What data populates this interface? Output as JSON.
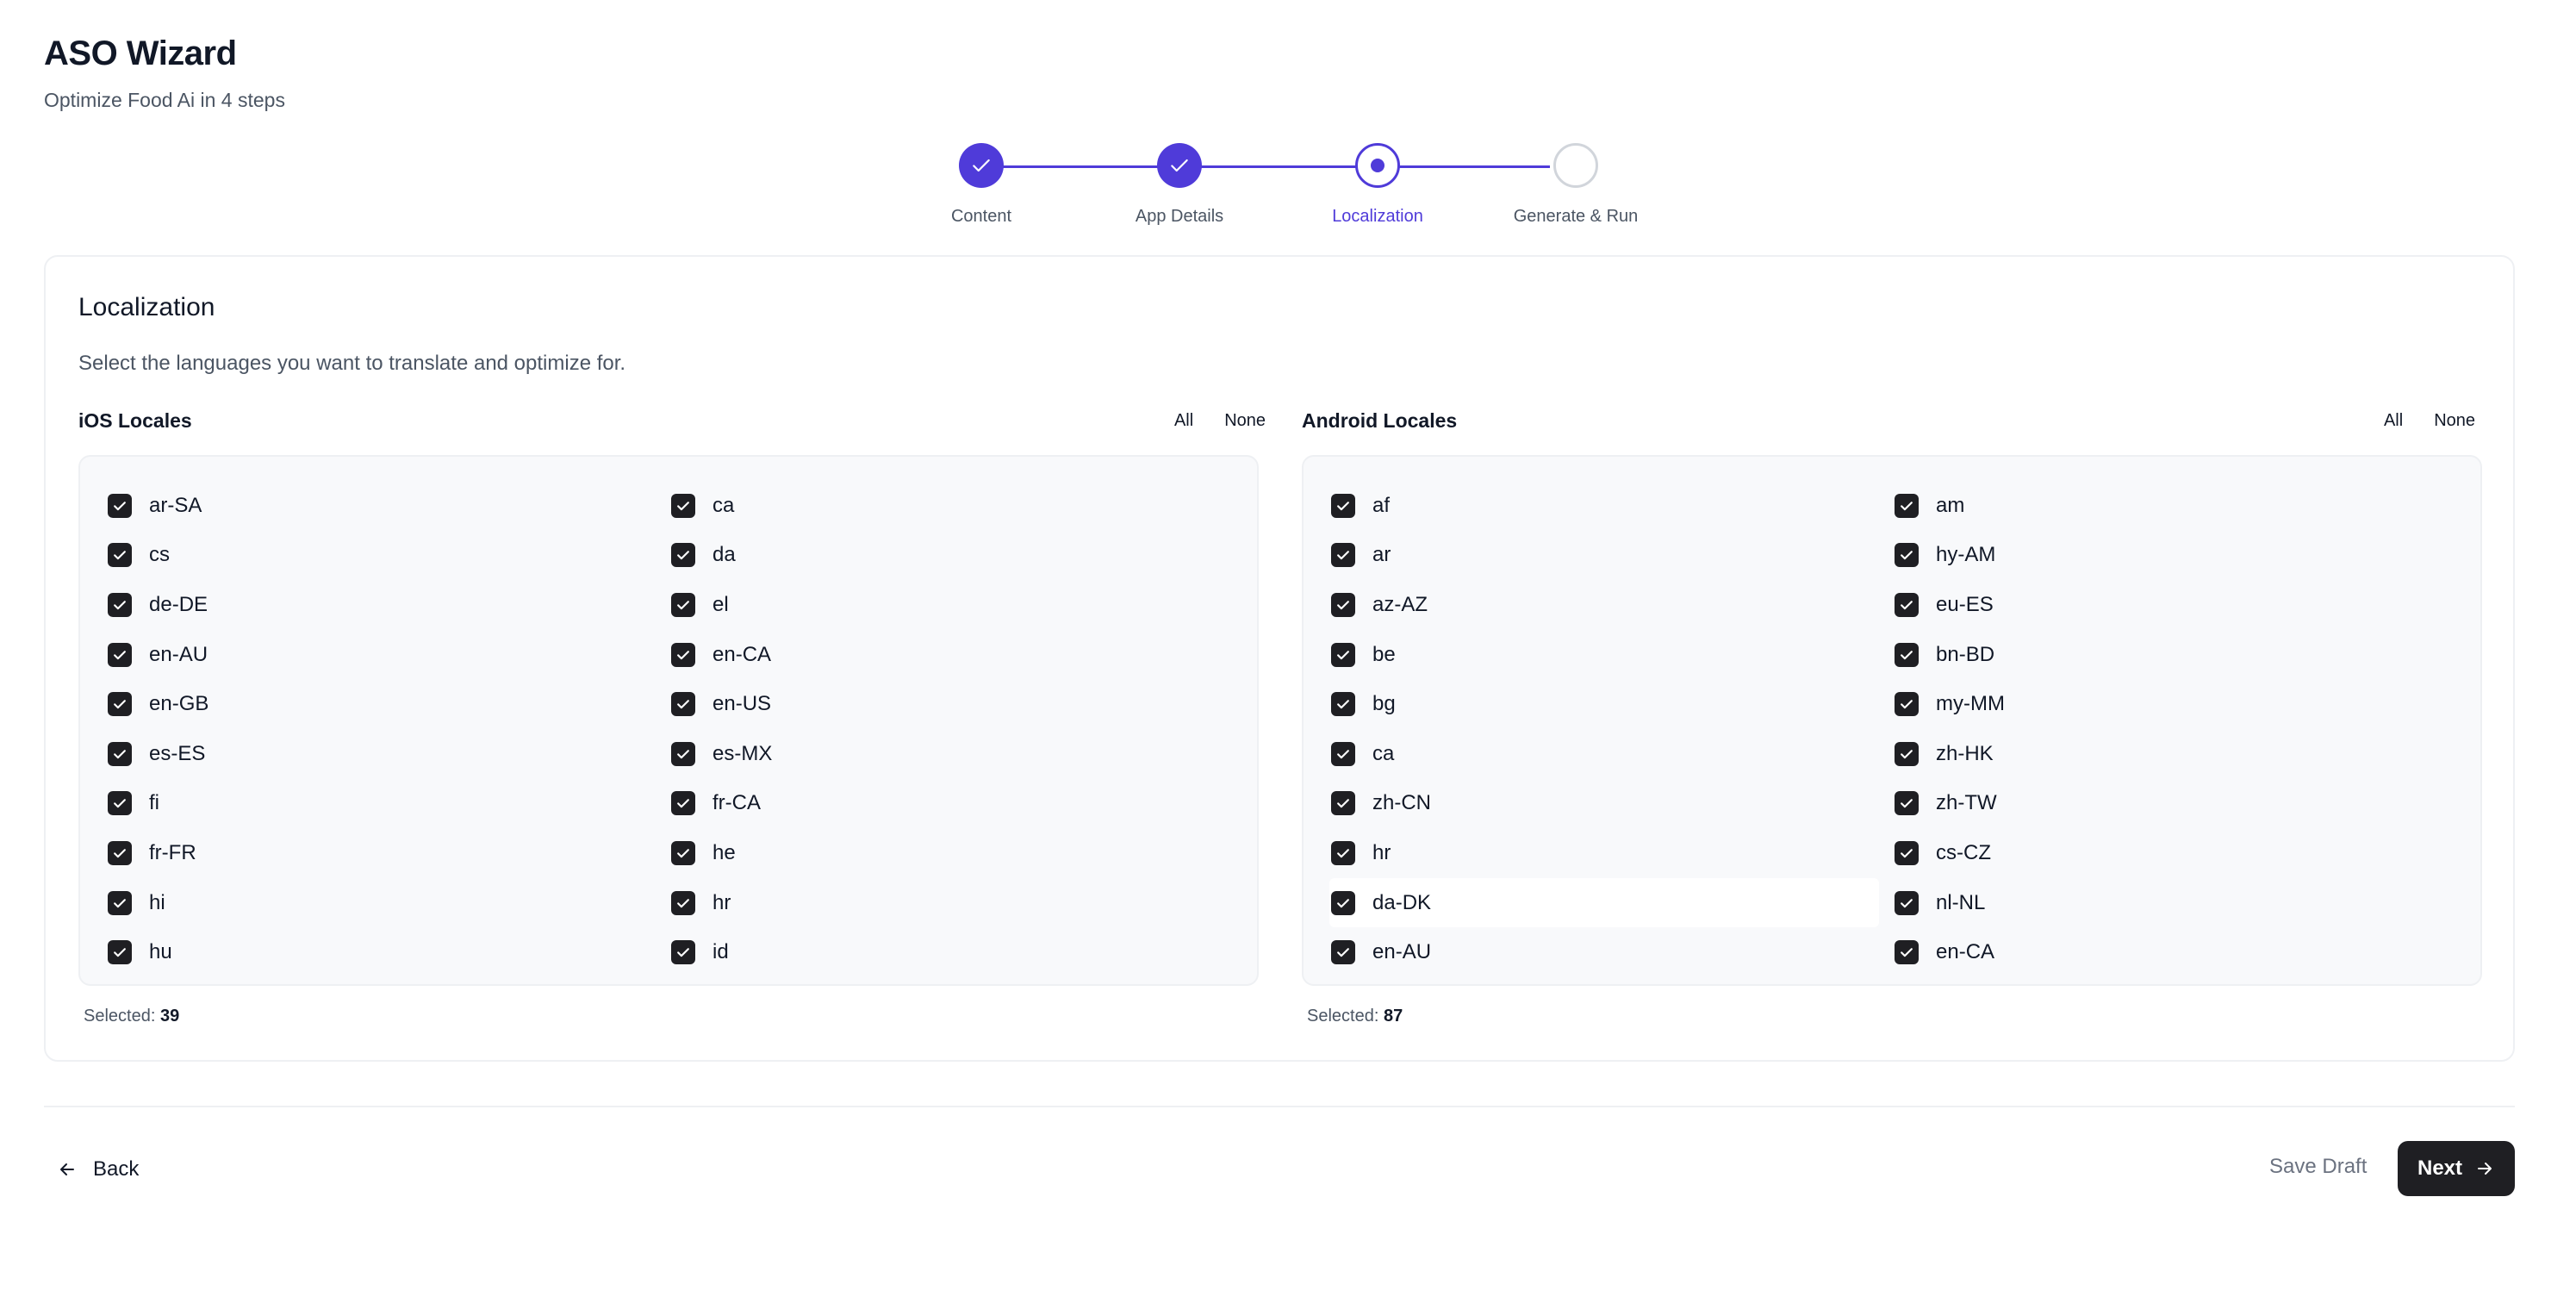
{
  "header": {
    "title": "ASO Wizard",
    "subtitle": "Optimize Food Ai in 4 steps"
  },
  "stepper": {
    "steps": [
      {
        "label": "Content",
        "state": "done"
      },
      {
        "label": "App Details",
        "state": "done"
      },
      {
        "label": "Localization",
        "state": "current"
      },
      {
        "label": "Generate & Run",
        "state": "todo"
      }
    ]
  },
  "card": {
    "title": "Localization",
    "description": "Select the languages you want to translate and optimize for."
  },
  "ios": {
    "title": "iOS Locales",
    "all_label": "All",
    "none_label": "None",
    "selected_label": "Selected:",
    "selected_count": "39",
    "locales": [
      "ar-SA",
      "ca",
      "cs",
      "da",
      "de-DE",
      "el",
      "en-AU",
      "en-CA",
      "en-GB",
      "en-US",
      "es-ES",
      "es-MX",
      "fi",
      "fr-CA",
      "fr-FR",
      "he",
      "hi",
      "hr",
      "hu",
      "id"
    ]
  },
  "android": {
    "title": "Android Locales",
    "all_label": "All",
    "none_label": "None",
    "selected_label": "Selected:",
    "selected_count": "87",
    "locales": [
      "af",
      "am",
      "ar",
      "hy-AM",
      "az-AZ",
      "eu-ES",
      "be",
      "bn-BD",
      "bg",
      "my-MM",
      "ca",
      "zh-HK",
      "zh-CN",
      "zh-TW",
      "hr",
      "cs-CZ",
      "da-DK",
      "nl-NL",
      "en-AU",
      "en-CA"
    ],
    "hovered": "da-DK"
  },
  "footer": {
    "back_label": "Back",
    "save_draft_label": "Save Draft",
    "next_label": "Next"
  },
  "colors": {
    "accent": "#4f3bd9",
    "checkbox": "#1f1f23",
    "primary_button": "#1f1f23"
  }
}
